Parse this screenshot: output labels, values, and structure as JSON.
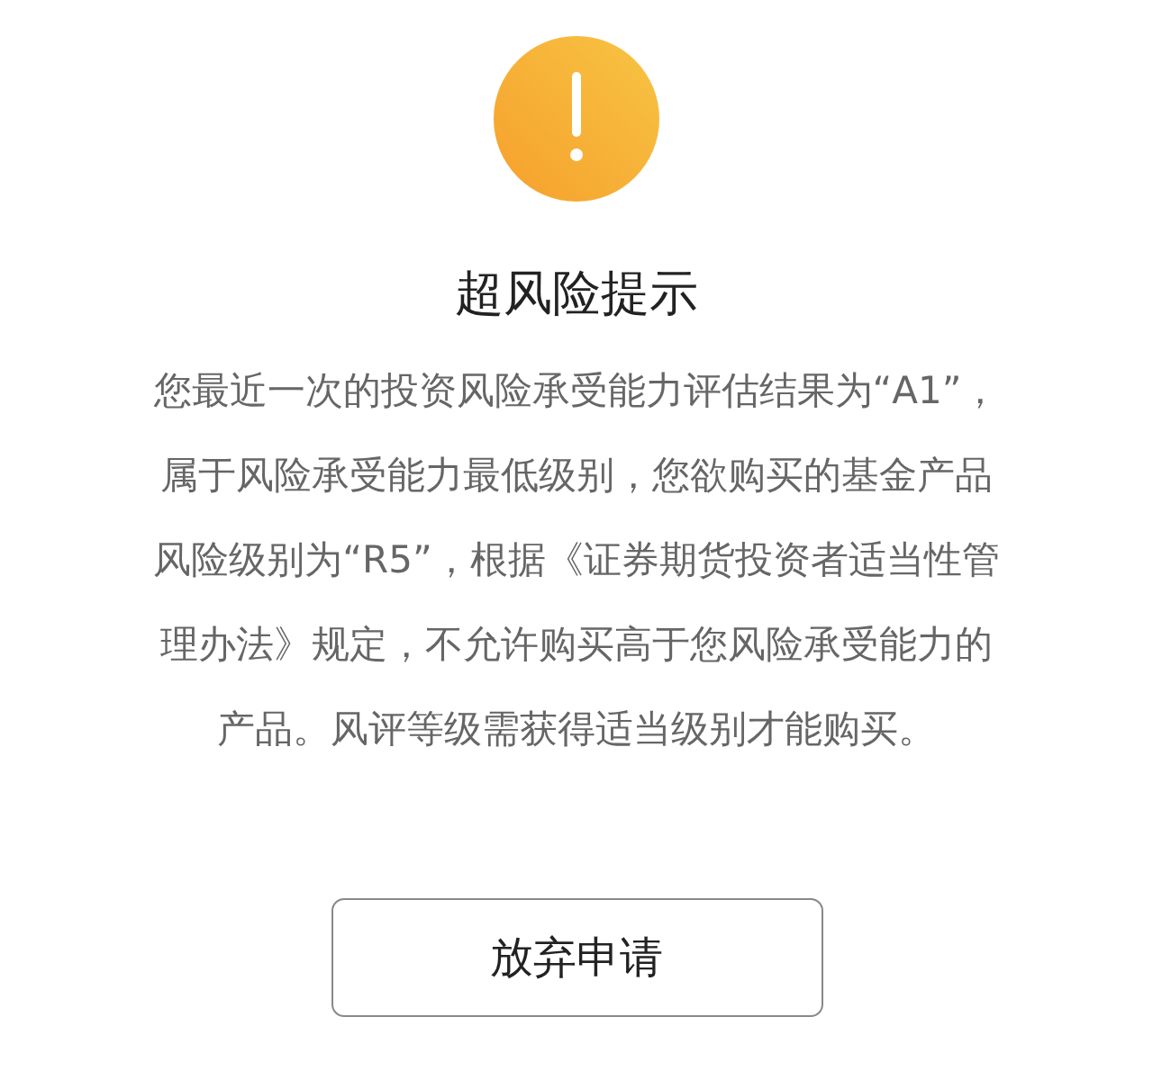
{
  "dialog": {
    "title": "超风险提示",
    "message": "您最近一次的投资风险承受能力评估结果为“A1”，属于风险承受能力最低级别，您欲购买的基金产品风险级别为“R5”，根据《证券期货投资者适当性管理办法》规定，不允许购买高于您风险承受能力的产品。风评等级需获得适当级别才能购买。",
    "buttons": [
      "放弃申请"
    ]
  }
}
